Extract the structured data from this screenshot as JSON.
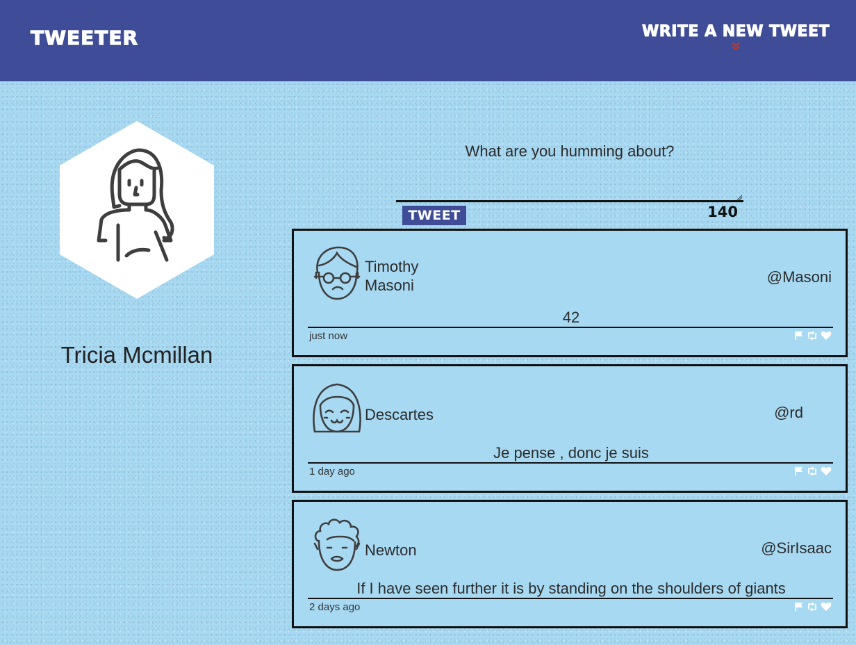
{
  "header": {
    "brand": "Tweeter",
    "compose_label": "Write a new tweet",
    "compose_icon": "chevron-double-down-icon",
    "chevron_color": "#c0392b"
  },
  "colors": {
    "header_bg": "#3f4c97",
    "page_bg": "#a8d9f2",
    "button_bg": "#3f4c97"
  },
  "profile": {
    "name": "Tricia Mcmillan",
    "avatar": "woman-long-hair-avatar"
  },
  "compose": {
    "placeholder": "What are you humming about?",
    "button_label": "Tweet",
    "counter": "140"
  },
  "tweets": [
    {
      "name": "Timothy Masoni",
      "handle": "@Masoni",
      "text": "42",
      "time": "just now",
      "avatar": "man-glasses-avatar"
    },
    {
      "name": "Descartes",
      "handle": "@rd",
      "text": "Je pense , donc je suis",
      "time": "1 day ago",
      "avatar": "smiling-bob-hair-avatar"
    },
    {
      "name": "Newton",
      "handle": "@SirIsaac",
      "text": "If I have seen further it is by standing on the shoulders of giants",
      "time": "2 days ago",
      "avatar": "curly-hair-avatar"
    }
  ],
  "tweet_actions": [
    "flag-icon",
    "retweet-icon",
    "heart-icon"
  ]
}
